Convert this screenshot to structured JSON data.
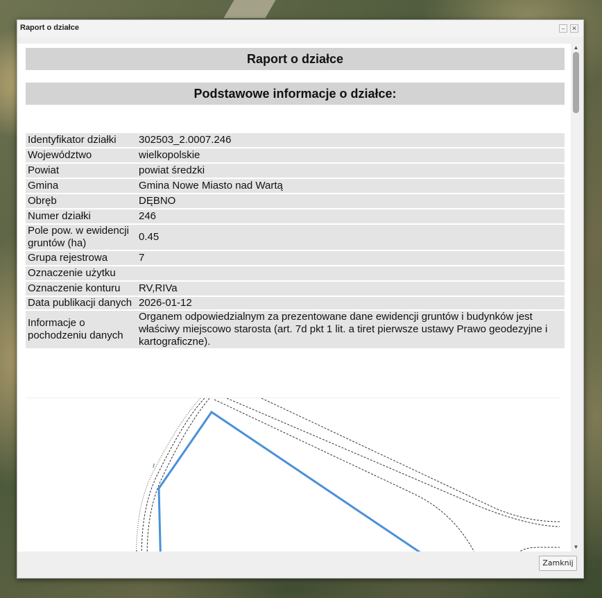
{
  "window": {
    "title": "Raport o działce",
    "minimize_icon": "minimize-icon",
    "close_icon": "close-icon"
  },
  "report": {
    "heading": "Raport o działce",
    "section_heading": "Podstawowe informacje o działce:"
  },
  "parcel_info": {
    "rows": [
      {
        "label": "Identyfikator działki",
        "value": "302503_2.0007.246"
      },
      {
        "label": "Województwo",
        "value": "wielkopolskie"
      },
      {
        "label": "Powiat",
        "value": "powiat średzki"
      },
      {
        "label": "Gmina",
        "value": "Gmina Nowe Miasto nad Wartą"
      },
      {
        "label": "Obręb",
        "value": "DĘBNO"
      },
      {
        "label": "Numer działki",
        "value": "246"
      },
      {
        "label": "Pole pow. w ewidencji gruntów (ha)",
        "value": "0.45"
      },
      {
        "label": "Grupa rejestrowa",
        "value": "7"
      },
      {
        "label": "Oznaczenie użytku",
        "value": ""
      },
      {
        "label": "Oznaczenie konturu",
        "value": "RV,RIVa"
      },
      {
        "label": "Data publikacji danych",
        "value": "2026-01-12"
      },
      {
        "label": "Informacje o pochodzeniu danych",
        "value": "Organem odpowiedzialnym za prezentowane dane ewidencji gruntów i budynków jest właściwy miejscowo starosta (art. 7d pkt 1 lit. a tiret pierwsze ustawy Prawo geodezyjne i kartograficzne)."
      }
    ]
  },
  "footer": {
    "close_label": "Zamknij"
  },
  "colors": {
    "parcel_outline": "#4a90d9",
    "header_bar": "#d3d3d3",
    "row_bg": "#e4e4e4"
  }
}
